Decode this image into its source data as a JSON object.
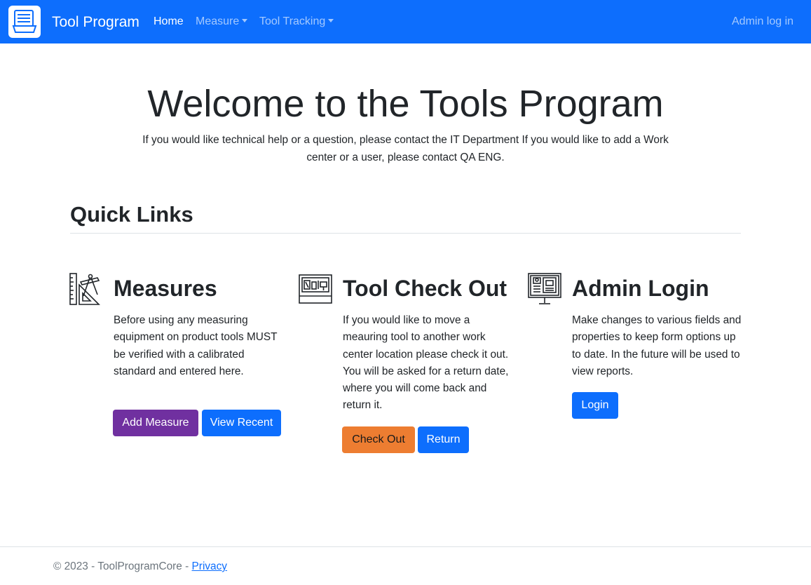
{
  "navbar": {
    "brand": "Tool Program",
    "brand_icon": "toolbox-icon",
    "home": "Home",
    "measure": "Measure",
    "tool_tracking": "Tool Tracking",
    "admin_login": "Admin log in",
    "color": "#0d6efd"
  },
  "hero": {
    "title": "Welcome to the Tools Program",
    "text": "If you would like technical help or a question, please contact the IT Department If you would like to add a Work center or a user, please contact QA ENG."
  },
  "quick_links": {
    "title": "Quick Links",
    "cards": [
      {
        "icon": "ruler-compass-icon",
        "title": "Measures",
        "text": "Before using any measuring equipment on product tools MUST be verified with a calibrated standard and entered here.",
        "buttons": [
          {
            "label": "Add Measure",
            "color": "#7030a0"
          },
          {
            "label": "View Recent",
            "color": "#0d6efd"
          }
        ]
      },
      {
        "icon": "toolbox-icon",
        "title": "Tool Check Out",
        "text": "If you would like to move a meauring tool to another work center location please check it out. You will be asked for a return date, where you will come back and return it.",
        "buttons": [
          {
            "label": "Check Out",
            "color": "#ed7d31"
          },
          {
            "label": "Return",
            "color": "#0d6efd"
          }
        ]
      },
      {
        "icon": "monitor-dashboard-icon",
        "title": "Admin Login",
        "text": "Make changes to various fields and properties to keep form options up to date. In the future will be used to view reports.",
        "buttons": [
          {
            "label": "Login",
            "color": "#0d6efd"
          }
        ]
      }
    ]
  },
  "footer": {
    "copyright": "© 2023 - ToolProgramCore - ",
    "privacy": "Privacy"
  }
}
